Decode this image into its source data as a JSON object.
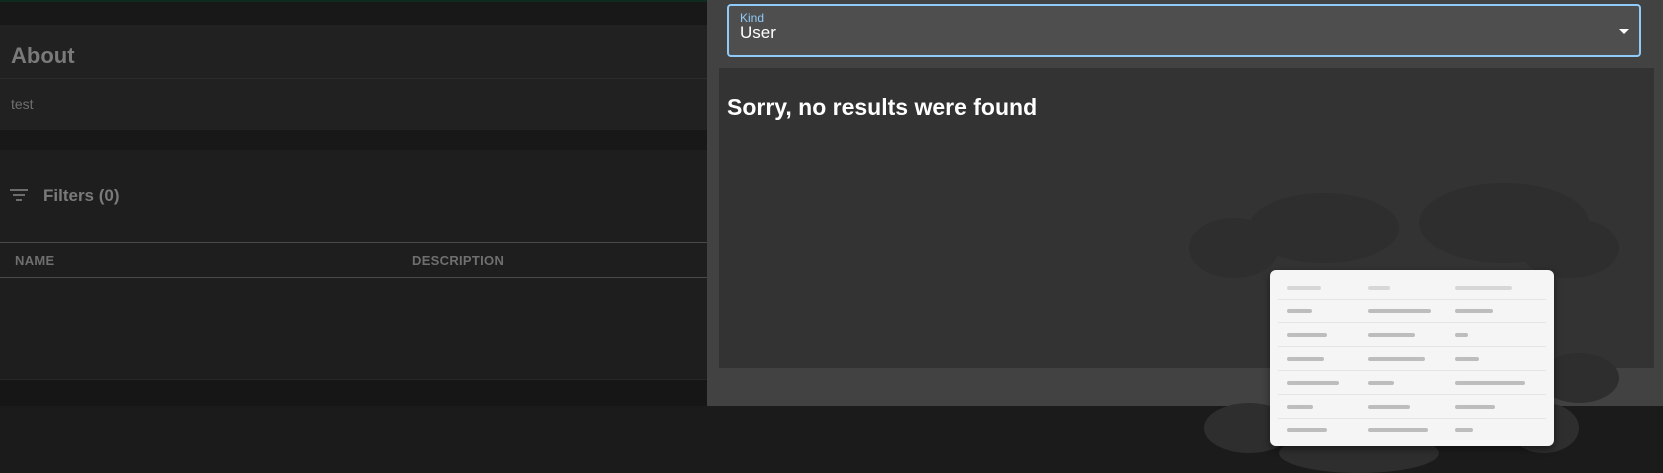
{
  "about": {
    "title": "About",
    "description": "test"
  },
  "filters": {
    "label": "Filters (0)",
    "icon": "filter-list-icon"
  },
  "table": {
    "columns": [
      "NAME",
      "DESCRIPTION"
    ],
    "rows": []
  },
  "drawer": {
    "kind_field": {
      "label": "Kind",
      "value": "User",
      "icon": "arrow-drop-down-icon"
    },
    "empty_state": {
      "title": "Sorry, no results were found",
      "illustration": "empty-table-illustration"
    }
  },
  "colors": {
    "accent": "#90caf9",
    "drawer_bg": "#424242",
    "panel_bg": "#333333",
    "backdrop_bg": "#161616"
  }
}
